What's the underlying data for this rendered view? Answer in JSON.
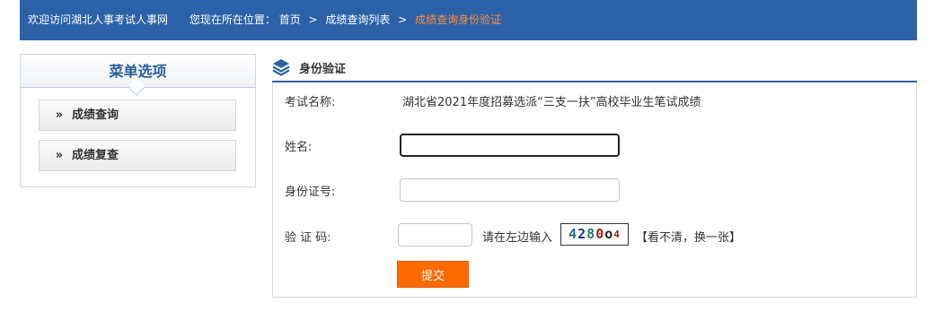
{
  "header": {
    "welcome": "欢迎访问湖北人事考试人事网",
    "location_label": "您现在所在位置：",
    "breadcrumb": [
      "首页",
      "成绩查询列表",
      "成绩查询身份验证"
    ],
    "separator": ">"
  },
  "sidebar": {
    "title": "菜单选项",
    "items": [
      {
        "label": "成绩查询"
      },
      {
        "label": "成绩复查"
      }
    ]
  },
  "panel": {
    "title": "身份验证",
    "exam_label": "考试名称:",
    "exam_name": "湖北省2021年度招募选派“三支一扶”高校毕业生笔试成绩",
    "name_label": "姓名:",
    "name_value": "",
    "id_label": "身份证号:",
    "id_value": "",
    "code_label": "验 证 码:",
    "code_value": "",
    "code_hint": "请在左边输入",
    "captcha_chars": [
      "4",
      "2",
      "8",
      "0",
      "o",
      "4"
    ],
    "refresh_text": "【看不清，换一张】",
    "submit_label": "提交"
  },
  "colors": {
    "header_bg": "#2b62a7",
    "breadcrumb_current": "#ff8c3a",
    "submit_bg": "#ff6a00"
  }
}
